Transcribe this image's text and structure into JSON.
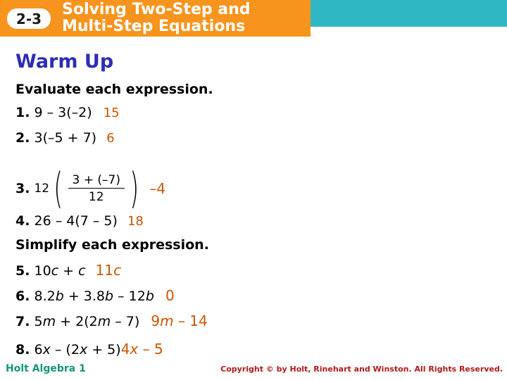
{
  "header": {
    "lesson_number": "2-3",
    "title_line1": "Solving Two-Step and",
    "title_line2": "Multi-Step Equations",
    "bar_color": "#f7941e",
    "accent_color": "#2fb8c4"
  },
  "section": {
    "heading": "Warm Up",
    "heading_color": "#2d2db5",
    "answer_color": "#cc5500"
  },
  "instructions": {
    "evaluate": "Evaluate each expression.",
    "simplify": "Simplify each expression."
  },
  "items": [
    {
      "num": "1.",
      "problem": "9 – 3(–2)",
      "answer": "15"
    },
    {
      "num": "2.",
      "problem": "3(–5 + 7)",
      "answer": "6"
    },
    {
      "num": "3.",
      "coefficient": "12",
      "fraction_numerator": "3 + (–7)",
      "fraction_denominator": "12",
      "answer": "–4"
    },
    {
      "num": "4.",
      "problem": "26 – 4(7 – 5)",
      "answer": "18"
    },
    {
      "num": "5.",
      "problem_pre": "10",
      "problem_var": "c",
      "problem_post": " + ",
      "problem_var2": "c",
      "answer_num": "11",
      "answer_var": "c"
    },
    {
      "num": "6.",
      "problem_a": "  8.2",
      "problem_var_a": "b",
      "problem_b": " + 3.8",
      "problem_var_b": "b",
      "problem_c": " – 12",
      "problem_var_c": "b",
      "answer": "0"
    },
    {
      "num": "7.",
      "problem_pre": "5",
      "problem_var": "m",
      "problem_mid": " + 2(2",
      "problem_var2": "m",
      "problem_post": " – 7)",
      "answer_pre": "9",
      "answer_var": "m",
      "answer_post": " – 14"
    },
    {
      "num": "8.",
      "problem_pre": "6",
      "problem_var": "x",
      "problem_mid": " – (2",
      "problem_var2": "x",
      "problem_post": " + 5)",
      "answer_pre": "4",
      "answer_var": "x",
      "answer_post": " – 5"
    }
  ],
  "footer": {
    "left": "Holt Algebra 1",
    "right": "Copyright © by Holt, Rinehart and Winston. All Rights Reserved.",
    "left_color": "#14967a",
    "right_color": "#b01a1a"
  }
}
